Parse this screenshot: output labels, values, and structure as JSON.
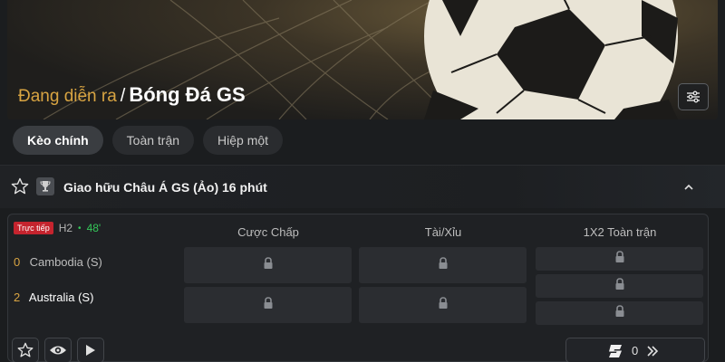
{
  "header": {
    "breadcrumb_live": "Đang diễn ra",
    "breadcrumb_sep": "/",
    "breadcrumb_sport": "Bóng Đá GS",
    "filter_icon": "sliders-icon"
  },
  "tabs": [
    {
      "label": "Kèo chính",
      "active": true
    },
    {
      "label": "Toàn trận",
      "active": false
    },
    {
      "label": "Hiệp một",
      "active": false
    }
  ],
  "league": {
    "name": "Giao hữu Châu Á GS (Ảo) 16 phút"
  },
  "match": {
    "live_badge": "Trực tiếp",
    "period": "H2",
    "dot": "•",
    "minute": "48'",
    "team1": {
      "score": "0",
      "name": "Cambodia (S)"
    },
    "team2": {
      "score": "2",
      "name": "Australia (S)"
    },
    "columns": [
      "Cược Chấp",
      "Tài/Xỉu",
      "1X2 Toàn trận"
    ],
    "more_count": "0"
  },
  "colors": {
    "accent": "#d8a442",
    "live_green": "#34c759",
    "live_badge": "#c5242e",
    "background": "#1b1d1f"
  }
}
